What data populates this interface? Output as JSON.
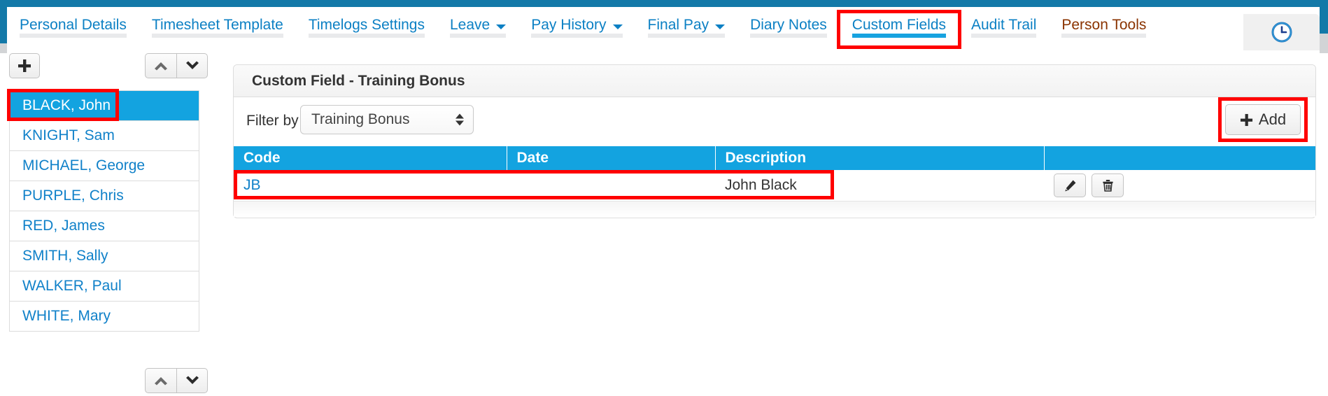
{
  "theme": {
    "brand_blue": "#13a3e0",
    "rail_blue": "#1379a8",
    "link_blue": "#1081c9",
    "tab_blue": "#0c80c4",
    "person_tools_brown": "#8a3300",
    "highlight_red": "#ff0000"
  },
  "tabs": [
    {
      "label": "Personal Details",
      "has_caret": false,
      "active": false,
      "highlighted": false,
      "style": "link"
    },
    {
      "label": "Timesheet Template",
      "has_caret": false,
      "active": false,
      "highlighted": false,
      "style": "link"
    },
    {
      "label": "Timelogs Settings",
      "has_caret": false,
      "active": false,
      "highlighted": false,
      "style": "link"
    },
    {
      "label": "Leave",
      "has_caret": true,
      "active": false,
      "highlighted": false,
      "style": "link"
    },
    {
      "label": "Pay History",
      "has_caret": true,
      "active": false,
      "highlighted": false,
      "style": "link"
    },
    {
      "label": "Final Pay",
      "has_caret": true,
      "active": false,
      "highlighted": false,
      "style": "link"
    },
    {
      "label": "Diary Notes",
      "has_caret": false,
      "active": false,
      "highlighted": false,
      "style": "link"
    },
    {
      "label": "Custom Fields",
      "has_caret": false,
      "active": true,
      "highlighted": true,
      "style": "link"
    },
    {
      "label": "Audit Trail",
      "has_caret": false,
      "active": false,
      "highlighted": false,
      "style": "link"
    },
    {
      "label": "Person Tools",
      "has_caret": false,
      "active": false,
      "highlighted": false,
      "style": "brown"
    }
  ],
  "clock_button": {
    "icon": "clock-icon"
  },
  "sidebar": {
    "add_button": {
      "icon": "plus-icon",
      "label": "+"
    },
    "nav_up": {
      "icon": "chevron-up-icon"
    },
    "nav_down": {
      "icon": "chevron-down-icon"
    },
    "people": [
      {
        "name": "BLACK, John",
        "selected": true
      },
      {
        "name": "KNIGHT, Sam",
        "selected": false
      },
      {
        "name": "MICHAEL, George",
        "selected": false
      },
      {
        "name": "PURPLE, Chris",
        "selected": false
      },
      {
        "name": "RED, James",
        "selected": false
      },
      {
        "name": "SMITH, Sally",
        "selected": false
      },
      {
        "name": "WALKER, Paul",
        "selected": false
      },
      {
        "name": "WHITE, Mary",
        "selected": false
      }
    ]
  },
  "panel": {
    "title": "Custom Field - Training Bonus",
    "filter": {
      "label": "Filter by",
      "selected_value": "Training Bonus",
      "options": [
        "Training Bonus"
      ]
    },
    "add_button": {
      "label": "Add",
      "icon": "plus-icon"
    },
    "table": {
      "columns": [
        "Code",
        "Date",
        "Description",
        ""
      ],
      "rows": [
        {
          "code": "JB",
          "date": "",
          "description": "John Black",
          "edit_icon": "pencil-icon",
          "delete_icon": "trash-icon"
        }
      ]
    }
  }
}
